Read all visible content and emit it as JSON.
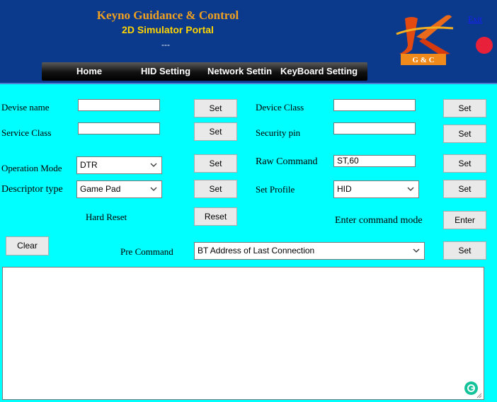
{
  "header": {
    "title": "Keyno Guidance & Control",
    "subtitle": "2D Simulator Portal",
    "dash": "---",
    "exit_label": "Exit",
    "logo_icon": "keyno-kgc-logo",
    "logo_text": "G & C",
    "status_color": "#e8203a"
  },
  "nav": {
    "items": [
      "Home",
      "HID Setting",
      "Network Settin",
      "KeyBoard Setting"
    ]
  },
  "form": {
    "devise_name_label": "Devise name",
    "devise_name_value": "",
    "device_class_label": "Device Class",
    "device_class_value": "",
    "service_class_label": "Service Class",
    "service_class_value": "",
    "security_pin_label": "Security pin",
    "security_pin_value": "",
    "operation_mode_label": "Operation Mode",
    "operation_mode_value": "DTR",
    "raw_command_label": "Raw Command",
    "raw_command_value": "ST,60",
    "descriptor_type_label": "Descriptor type",
    "descriptor_type_value": "Game Pad",
    "set_profile_label": "Set Profile",
    "set_profile_value": "HID",
    "hard_reset_label": "Hard Reset",
    "reset_label": "Reset",
    "enter_command_label": "Enter command mode",
    "enter_label": "Enter",
    "clear_label": "Clear",
    "pre_command_label": "Pre Command",
    "pre_command_value": "BT Address of Last Connection",
    "set_label": "Set"
  },
  "output": {
    "value": ""
  }
}
